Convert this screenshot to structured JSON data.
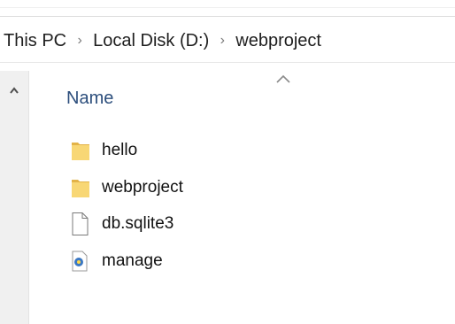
{
  "breadcrumb": {
    "items": [
      "This PC",
      "Local Disk (D:)",
      "webproject"
    ],
    "separator": "›"
  },
  "columns": {
    "name_label": "Name",
    "sort_icon": "chevron-up-icon"
  },
  "files": [
    {
      "name": "hello",
      "icon": "folder-icon",
      "type": "folder"
    },
    {
      "name": "webproject",
      "icon": "folder-icon",
      "type": "folder"
    },
    {
      "name": "db.sqlite3",
      "icon": "blank-file-icon",
      "type": "file"
    },
    {
      "name": "manage",
      "icon": "python-file-icon",
      "type": "file"
    }
  ],
  "colors": {
    "folder": "#f8d775",
    "folder_dark": "#e3b348",
    "header_text": "#2c4e7c",
    "python_blue": "#3b78c4"
  }
}
